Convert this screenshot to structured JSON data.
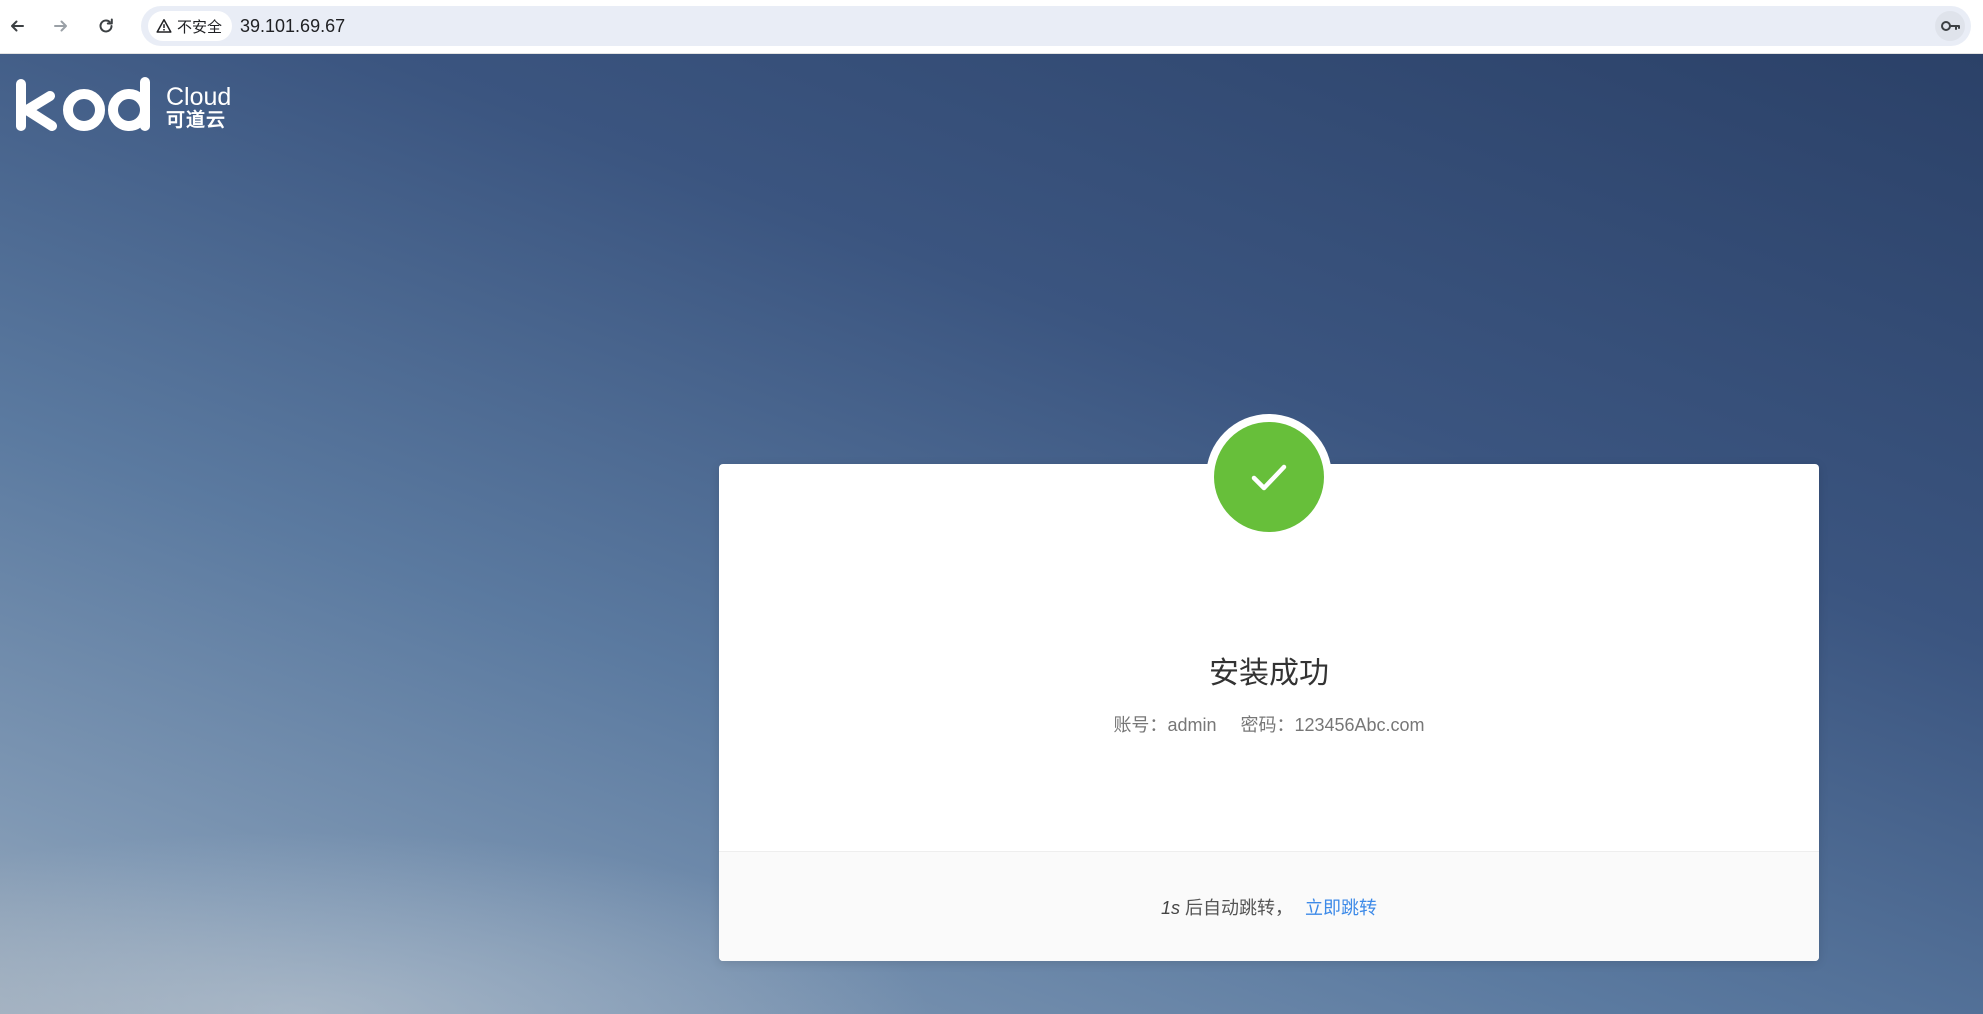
{
  "browser": {
    "security_label": "不安全",
    "url": "39.101.69.67",
    "icons": {
      "back": "arrow-left-icon",
      "forward": "arrow-right-icon",
      "reload": "reload-icon",
      "security": "warning-triangle-icon",
      "password": "key-icon"
    }
  },
  "logo": {
    "kod": "kod",
    "cloud": "Cloud",
    "cn": "可道云"
  },
  "card": {
    "icon": "checkmark-icon",
    "title": "安装成功",
    "account_label": "账号：",
    "account_value": "admin",
    "password_label": "密码：",
    "password_value": "123456Abc.com",
    "countdown_value": "1s",
    "countdown_text": "后自动跳转，",
    "jump_label": "立即跳转"
  },
  "colors": {
    "success": "#67bf3a",
    "link": "#3d8ae8",
    "background_top": "#2b4168",
    "background_bottom": "#9aaabb"
  }
}
